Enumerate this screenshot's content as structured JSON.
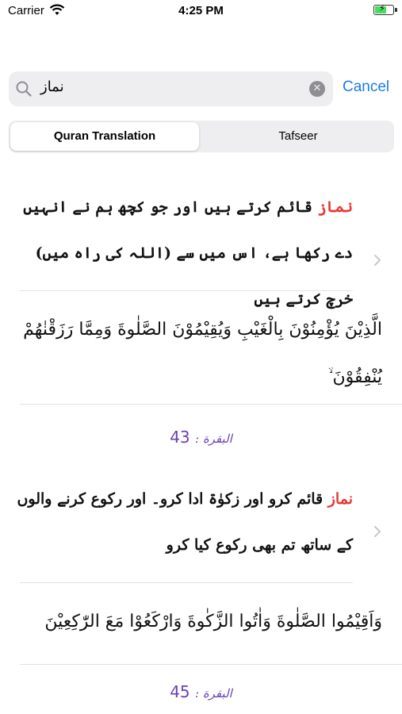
{
  "status_bar": {
    "carrier": "Carrier",
    "time": "4:25 PM"
  },
  "search": {
    "value": "نماز",
    "cancel_label": "Cancel"
  },
  "tabs": [
    {
      "label": "Quran Translation",
      "selected": true
    },
    {
      "label": "Tafseer",
      "selected": false
    }
  ],
  "results": [
    {
      "highlight": "نماز",
      "translation_rest": " قائم کرتے ہیں اور جو کچھ ہم نے انہیں دے رکھا ہے، اس میں سے (اللہ کی راہ میں) خرچ کرتے ہیں",
      "arabic": "الَّذِيْنَ يُؤْمِنُوْنَ بِالْغَيْبِ وَيُقِيْمُوْنَ الصَّلٰوةَ وَمِمَّا رَزَقْنٰهُمْ يُنْفِقُوْنَ ۙ",
      "reference_surah": "البقرة :",
      "reference_ayah": "43"
    },
    {
      "highlight": "نماز",
      "translation_rest": " قائم کرو اور زکوٰۃ ادا کرو۔ اور رکوع کرنے والوں کے ساتھ تم بھی رکوع کیا کرو",
      "arabic": "وَاَقِيْمُوا الصَّلٰوةَ وَاٰتُوا الزَّكٰوةَ وَارْكَعُوْا مَعَ الرّٰكِعِيْنَ",
      "reference_surah": "البقرة :",
      "reference_ayah": "45"
    }
  ],
  "colors": {
    "accent": "#1a7ce6",
    "highlight": "#e53935",
    "reference": "#6a3fb8"
  },
  "icons": [
    "wifi-icon",
    "battery-icon",
    "search-icon",
    "clear-icon",
    "chevron-right-icon"
  ]
}
